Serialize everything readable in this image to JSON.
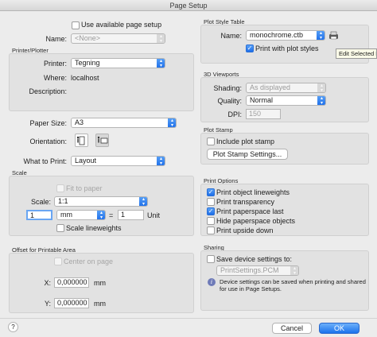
{
  "window": {
    "title": "Page Setup"
  },
  "use_available": {
    "label": "Use available page setup",
    "checked": false
  },
  "name": {
    "label": "Name:",
    "value": "<None>"
  },
  "printer_plotter": {
    "section": "Printer/Plotter",
    "printer_label": "Printer:",
    "printer_value": "Tegning",
    "where_label": "Where:",
    "where_value": "localhost",
    "description_label": "Description:",
    "description_value": ""
  },
  "paper_size": {
    "label": "Paper Size:",
    "value": "A3"
  },
  "orientation": {
    "label": "Orientation:",
    "selected": "landscape"
  },
  "what_to_print": {
    "label": "What to Print:",
    "value": "Layout"
  },
  "scale": {
    "section": "Scale",
    "fit_label": "Fit to paper",
    "fit_checked": false,
    "scale_label": "Scale:",
    "scale_value": "1:1",
    "numerator": "1",
    "units_value": "mm",
    "equals": "=",
    "denominator": "1",
    "unit_label": "Unit",
    "lineweights_label": "Scale lineweights",
    "lineweights_checked": false
  },
  "offset": {
    "section": "Offset for Printable Area",
    "center_label": "Center on page",
    "center_checked": false,
    "x_label": "X:",
    "x_value": "0,000000",
    "x_unit": "mm",
    "y_label": "Y:",
    "y_value": "0,000000",
    "y_unit": "mm"
  },
  "plot_style": {
    "section": "Plot Style Table",
    "name_label": "Name:",
    "name_value": "monochrome.ctb",
    "print_with_label": "Print with plot styles",
    "print_with_checked": true,
    "tooltip": "Edit Selected F"
  },
  "viewports": {
    "section": "3D Viewports",
    "shading_label": "Shading:",
    "shading_value": "As displayed",
    "quality_label": "Quality:",
    "quality_value": "Normal",
    "dpi_label": "DPI:",
    "dpi_value": "150"
  },
  "plot_stamp": {
    "section": "Plot Stamp",
    "include_label": "Include plot stamp",
    "include_checked": false,
    "settings_button": "Plot Stamp Settings..."
  },
  "print_options": {
    "section": "Print Options",
    "items": [
      {
        "label": "Print object lineweights",
        "checked": true
      },
      {
        "label": "Print transparency",
        "checked": false
      },
      {
        "label": "Print paperspace last",
        "checked": true
      },
      {
        "label": "Hide paperspace objects",
        "checked": false
      },
      {
        "label": "Print upside down",
        "checked": false
      }
    ]
  },
  "sharing": {
    "section": "Sharing",
    "save_label": "Save device settings to:",
    "save_checked": false,
    "file_value": "PrintSettings.PCM",
    "info_line1": "Device settings can be saved when printing and shared",
    "info_line2": "for use in Page Setups."
  },
  "footer": {
    "help": "?",
    "cancel": "Cancel",
    "ok": "OK"
  },
  "colors": {
    "accent": "#1d6ee9",
    "panel": "#e2e2e2",
    "window": "#ececec"
  }
}
